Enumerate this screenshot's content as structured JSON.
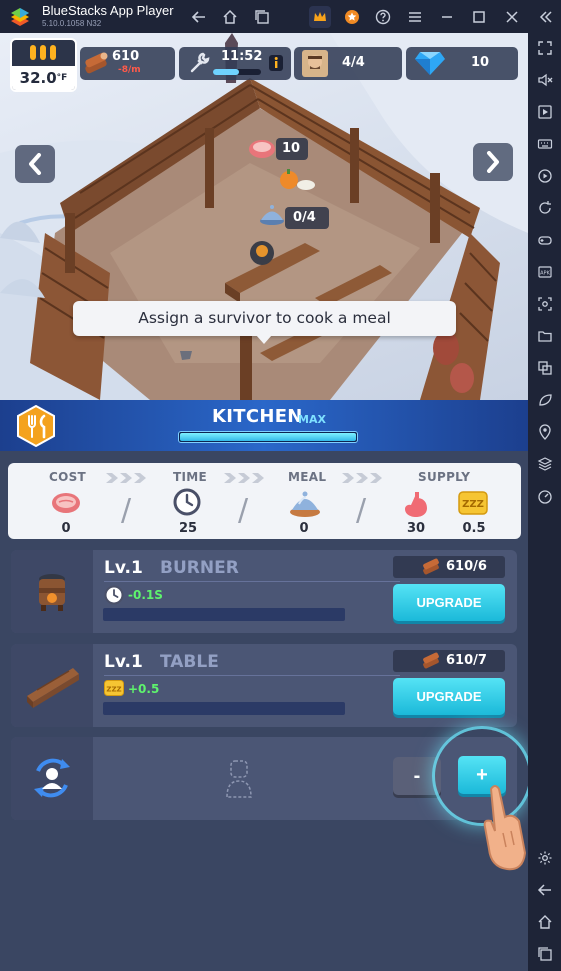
{
  "titlebar": {
    "app_name": "BlueStacks App Player",
    "version": "5.10.0.1058  N32"
  },
  "hud": {
    "temperature": "32.0",
    "temperature_unit": "°F",
    "wood_amount": "610",
    "wood_rate": "-8/m",
    "clock": "11:52",
    "survivors": "4/4",
    "gems": "10"
  },
  "scene": {
    "meat_count": "10",
    "meal_slots": "0/4",
    "tooltip": "Assign a survivor to cook a meal"
  },
  "kitchen": {
    "title": "KITCHEN",
    "level_tag": "MAX",
    "progress": 1.0
  },
  "stats": {
    "headers": {
      "cost": "COST",
      "time": "TIME",
      "meal": "MEAL",
      "supply": "SUPPLY"
    },
    "cost": "0",
    "time": "25",
    "meal": "0",
    "supply_food": "30",
    "supply_sleep": "0.5"
  },
  "upgrades": [
    {
      "level": "Lv.1",
      "name": "BURNER",
      "stat_value": "-0.1S",
      "stat_color": "#5ef36d",
      "cost": "610/6",
      "button": "UPGRADE",
      "progress": 0.0
    },
    {
      "level": "Lv.1",
      "name": "TABLE",
      "stat_value": "+0.5",
      "stat_color": "#5ef36d",
      "cost": "610/7",
      "button": "UPGRADE",
      "progress": 0.0
    }
  ],
  "worker": {
    "minus": "-",
    "plus": "+"
  },
  "colors": {
    "accent_cyan": "#1bb9d9",
    "header_blue": "#2a67c9",
    "panel_bg": "#3a4662",
    "row_bg": "#4b5675",
    "stat_green": "#5ef36d"
  },
  "icons": {
    "titlebar": [
      "back-icon",
      "home-icon",
      "multi-window-icon",
      "crown-icon",
      "star-badge-icon",
      "help-icon",
      "menu-icon",
      "minimize-icon",
      "maximize-icon",
      "close-icon",
      "collapse-sidebar-icon"
    ],
    "sidebar": [
      "fullscreen-icon",
      "volume-icon",
      "screen-record-icon",
      "keyboard-icon",
      "macro-icon",
      "rotate-icon",
      "gamepad-icon",
      "install-apk-icon",
      "screenshot-icon",
      "folder-icon",
      "multi-instance-icon",
      "eco-mode-icon",
      "location-icon",
      "layers-icon",
      "speed-icon",
      "settings-icon",
      "android-back-icon",
      "android-home-icon",
      "android-recents-icon"
    ]
  }
}
